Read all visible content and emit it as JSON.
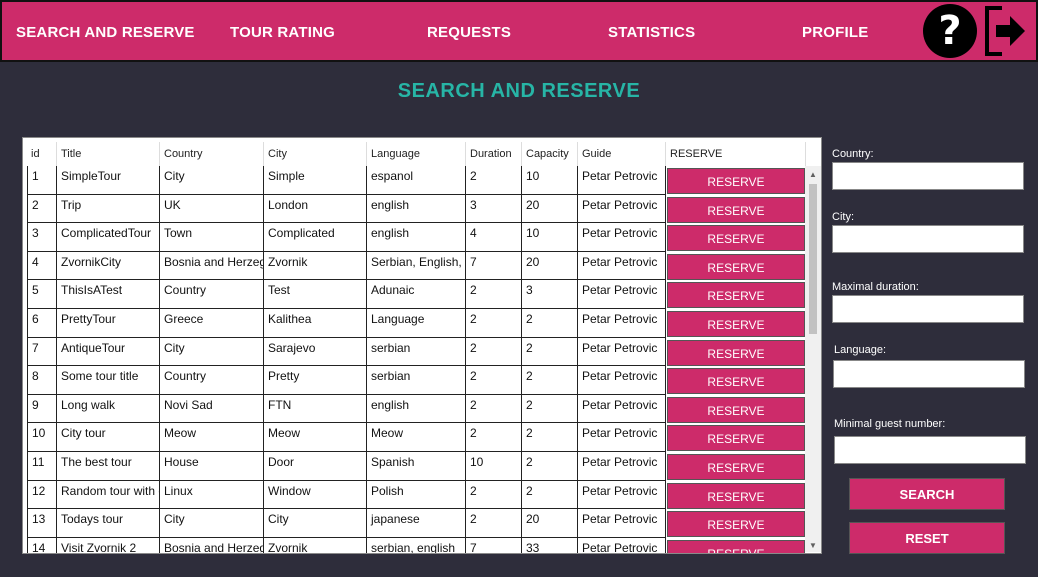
{
  "nav": {
    "search_and_reserve": "SEARCH AND RESERVE",
    "tour_rating": "TOUR RATING",
    "requests": "REQUESTS",
    "statistics": "STATISTICS",
    "profile": "PROFILE",
    "help_icon": "?",
    "help_icon_name": "question-mark-icon",
    "logout_icon_name": "logout-arrow-icon"
  },
  "page_title": "SEARCH AND RESERVE",
  "colors": {
    "accent": "#cd2b6a",
    "title": "#27b5a6",
    "background": "#2e2d3b"
  },
  "table": {
    "headers": [
      "id",
      "Title",
      "Country",
      "City",
      "Language",
      "Duration",
      "Capacity",
      "Guide",
      "RESERVE"
    ],
    "rows": [
      [
        "1",
        "SimpleTour",
        "City",
        "Simple",
        "espanol",
        "2",
        "10",
        "Petar Petrovic"
      ],
      [
        "2",
        "Trip",
        "UK",
        "London",
        "english",
        "3",
        "20",
        "Petar Petrovic"
      ],
      [
        "3",
        "ComplicatedTour",
        "Town",
        "Complicated",
        "english",
        "4",
        "10",
        "Petar Petrovic"
      ],
      [
        "4",
        "ZvornikCity",
        "Bosnia and Herzegovina",
        "Zvornik",
        "Serbian, English, Latin",
        "7",
        "20",
        "Petar Petrovic"
      ],
      [
        "5",
        "ThisIsATest",
        "Country",
        "Test",
        "Adunaic",
        "2",
        "3",
        "Petar Petrovic"
      ],
      [
        "6",
        "PrettyTour",
        "Greece",
        "Kalithea",
        "Language",
        "2",
        "2",
        "Petar Petrovic"
      ],
      [
        "7",
        "AntiqueTour",
        "City",
        "Sarajevo",
        "serbian",
        "2",
        "2",
        "Petar Petrovic"
      ],
      [
        "8",
        "Some tour title",
        "Country",
        "Pretty",
        "serbian",
        "2",
        "2",
        "Petar Petrovic"
      ],
      [
        "9",
        "Long walk",
        "Novi Sad",
        "FTN",
        "english",
        "2",
        "2",
        "Petar Petrovic"
      ],
      [
        "10",
        "City tour",
        "Meow",
        "Meow",
        "Meow",
        "2",
        "2",
        "Petar Petrovic"
      ],
      [
        "11",
        "The best tour",
        "House",
        "Door",
        "Spanish",
        "10",
        "2",
        "Petar Petrovic"
      ],
      [
        "12",
        "Random tour with coffee",
        "Linux",
        "Window",
        "Polish",
        "2",
        "2",
        "Petar Petrovic"
      ],
      [
        "13",
        "Todays tour",
        "City",
        "City",
        "japanese",
        "2",
        "20",
        "Petar Petrovic"
      ],
      [
        "14",
        "Visit Zvornik 2",
        "Bosnia and Herzegovina",
        "Zvornik",
        "serbian, english",
        "7",
        "33",
        "Petar Petrovic"
      ]
    ],
    "reserve_label": "RESERVE"
  },
  "filters": {
    "country_label": "Country:",
    "city_label": "City:",
    "max_duration_label": "Maximal duration:",
    "language_label": "Language:",
    "min_guests_label": "Minimal guest number:",
    "country_value": "",
    "city_value": "",
    "max_duration_value": "",
    "language_value": "",
    "min_guests_value": ""
  },
  "buttons": {
    "search": "SEARCH",
    "reset": "RESET"
  },
  "scroll": {
    "up_icon": "▲",
    "down_icon": "▼"
  }
}
